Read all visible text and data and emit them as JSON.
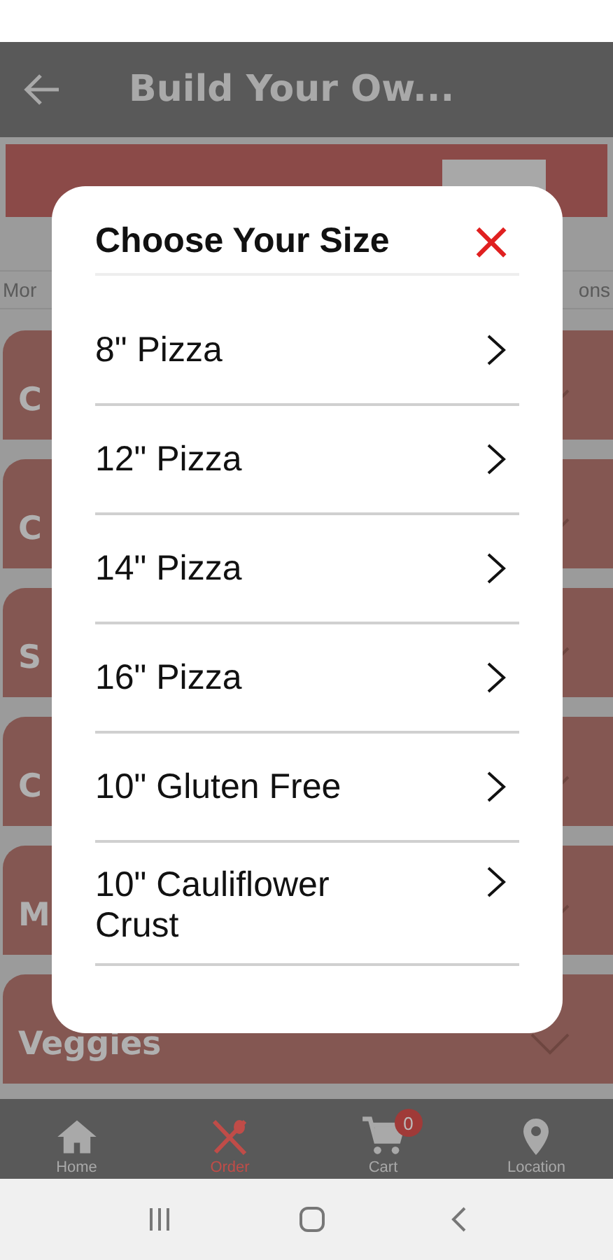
{
  "app_bar": {
    "title": "Build Your Ow..."
  },
  "options_row": {
    "left_text": "Mor",
    "right_text": "ons"
  },
  "categories": [
    {
      "label": "C"
    },
    {
      "label": "C"
    },
    {
      "label": "S"
    },
    {
      "label": "C"
    },
    {
      "label": "M"
    },
    {
      "label": "Veggies"
    }
  ],
  "bottom_nav": [
    {
      "label": "Home",
      "kind": "home",
      "selected": false
    },
    {
      "label": "Order",
      "kind": "order",
      "selected": true
    },
    {
      "label": "Cart",
      "kind": "cart",
      "selected": false,
      "badge": "0"
    },
    {
      "label": "Location",
      "kind": "location",
      "selected": false
    }
  ],
  "dialog": {
    "title": "Choose Your Size",
    "close": "×",
    "options": [
      {
        "label": "8\" Pizza"
      },
      {
        "label": "12\" Pizza"
      },
      {
        "label": "14\" Pizza"
      },
      {
        "label": "16\" Pizza"
      },
      {
        "label": "10\" Gluten Free"
      },
      {
        "label": "10\" Cauliflower Crust"
      }
    ]
  }
}
